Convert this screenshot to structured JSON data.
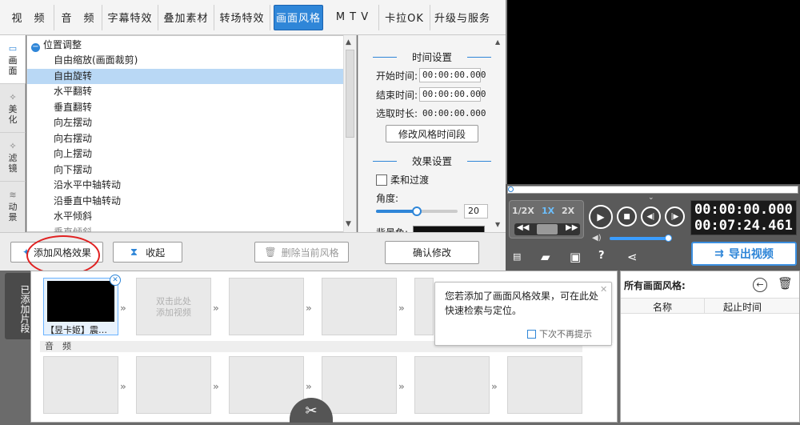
{
  "tabs": [
    "视　频",
    "音　频",
    "字幕特效",
    "叠加素材",
    "转场特效",
    "画面风格",
    "M T V",
    "卡拉OK",
    "升级与服务"
  ],
  "side_tabs": [
    {
      "label": "画\n面",
      "icon": "screen-icon"
    },
    {
      "label": "美\n化",
      "icon": "wand-icon"
    },
    {
      "label": "滤\n镜",
      "icon": "wand-icon"
    },
    {
      "label": "动\n景",
      "icon": "wave-icon"
    }
  ],
  "list": {
    "group": "位置调整",
    "items": [
      "自由缩放(画面裁剪)",
      "自由旋转",
      "水平翻转",
      "垂直翻转",
      "向左摆动",
      "向右摆动",
      "向上摆动",
      "向下摆动",
      "沿水平中轴转动",
      "沿垂直中轴转动",
      "水平倾斜",
      "垂直倾斜"
    ],
    "selected_index": 1
  },
  "settings": {
    "time_title": "时间设置",
    "start_label": "开始时间:",
    "start_value": "00:00:00.000",
    "end_label": "结束时间:",
    "end_value": "00:00:00.000",
    "duration_label": "选取时长:",
    "duration_value": "00:00:00.000",
    "modify_time_btn": "修改风格时间段",
    "effect_title": "效果设置",
    "smooth_label": "柔和过渡",
    "angle_label": "角度:",
    "angle_value": "20",
    "angle_fraction": 0.5,
    "bg_label": "背景色:",
    "confirm_btn": "确认修改"
  },
  "actions": {
    "add_effect": "添加风格效果",
    "collapse": "收起",
    "delete_current": "删除当前风格"
  },
  "player": {
    "speeds": [
      "1/2X",
      "1X",
      "2X"
    ],
    "current_time": "00:00:00.000",
    "total_time": "00:07:24.461",
    "export_label": "导出视频",
    "volume_fraction": 0.95
  },
  "timeline": {
    "side_label": "已添加片段",
    "clip_name": "【昱卡姬】震…",
    "empty_hint_1": "双击此处",
    "empty_hint_2": "添加视频",
    "audio_label": "音　频"
  },
  "tooltip": {
    "text": "您若添加了画面风格效果，可在此处快速检索与定位。",
    "no_remind": "下次不再提示"
  },
  "styles_panel": {
    "title": "所有画面风格:",
    "col_name": "名称",
    "col_time": "起止时间"
  },
  "colors": {
    "accent": "#2f86d8",
    "selection": "#b9d8f5",
    "annotation": "#e02020"
  }
}
